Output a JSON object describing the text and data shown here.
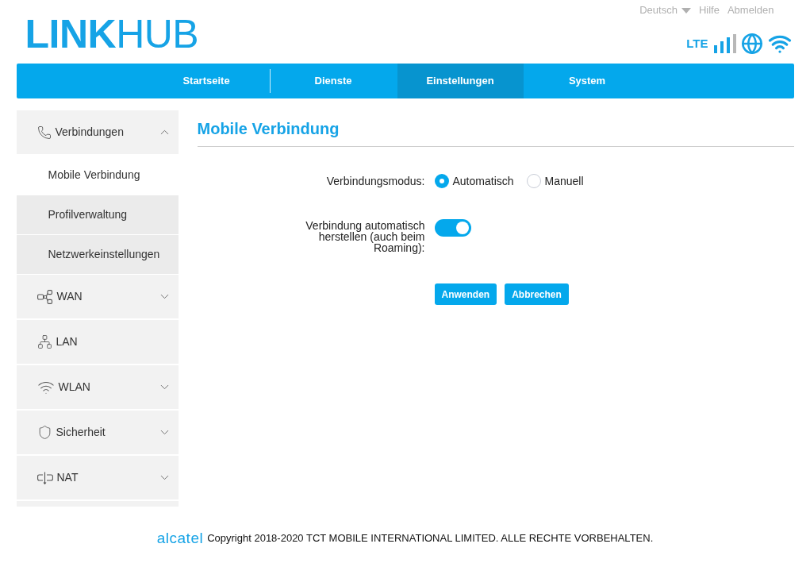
{
  "header": {
    "logo": "**LINK**HUB",
    "language": "Deutsch",
    "links": [
      "Hilfe",
      "Abmelden"
    ],
    "network_type": "LTE"
  },
  "nav": {
    "tabs": [
      {
        "label": "Startseite",
        "selected": false
      },
      {
        "label": "Dienste",
        "selected": false
      },
      {
        "label": "Einstellungen",
        "selected": true
      },
      {
        "label": "System",
        "selected": false
      }
    ]
  },
  "sidebar": {
    "items": [
      {
        "kind": "group",
        "label": "Verbindungen",
        "expanded": true,
        "children": [
          {
            "label": "Mobile Verbindung",
            "selected": true
          },
          {
            "label": "Profilverwaltung",
            "selected": false
          },
          {
            "label": "Netzwerkeinstellungen",
            "selected": false
          }
        ]
      },
      {
        "kind": "group",
        "label": "WAN",
        "expanded": false
      },
      {
        "kind": "link",
        "label": "LAN"
      },
      {
        "kind": "group",
        "label": "WLAN",
        "expanded": false
      },
      {
        "kind": "group",
        "label": "Sicherheit",
        "expanded": false
      },
      {
        "kind": "group",
        "label": "NAT",
        "expanded": false
      }
    ]
  },
  "page": {
    "title": "Mobile Verbindung"
  },
  "form": {
    "mode": {
      "label": "Verbindungsmodus:",
      "options": [
        {
          "label": "Automatisch",
          "selected": true
        },
        {
          "label": "Manuell",
          "selected": false
        }
      ]
    },
    "auto_connect": {
      "label": "Verbindung automatisch herstellen (auch beim Roaming):",
      "on": true
    },
    "buttons": [
      "Anwenden",
      "Abbrechen"
    ]
  },
  "footer": {
    "brand": "alcatel",
    "copyright": "Copyright 2018-2020 TCT MOBILE INTERNATIONAL LIMITED. ALLE RECHTE VORBEHALTEN."
  }
}
